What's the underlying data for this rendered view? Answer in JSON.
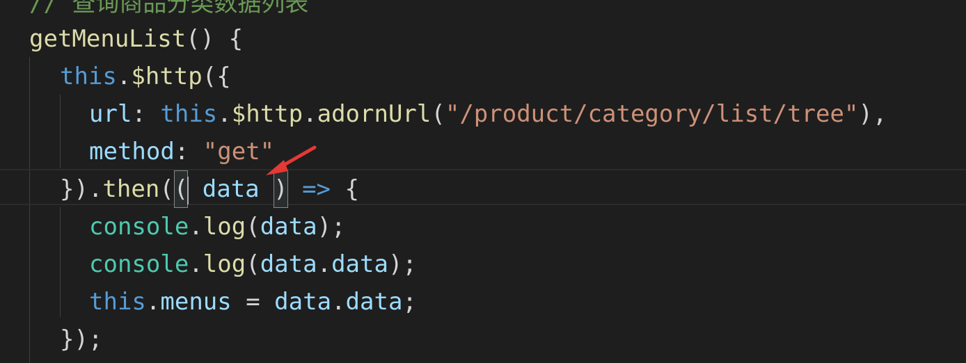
{
  "colors": {
    "background": "#1e1e1e",
    "comment": "#6a9955",
    "function": "#dcdcaa",
    "keyword": "#569cd6",
    "property": "#9cdcfe",
    "string": "#ce9178",
    "class": "#4ec9b0",
    "punctuation": "#d4d4d4",
    "annotation_arrow": "#e53935"
  },
  "code": {
    "comment": "// 查询商品分类数据列表",
    "line2": {
      "func": "getMenuList",
      "rest": "() {"
    },
    "line3": {
      "kw": "this",
      "dot": ".",
      "func": "$http",
      "rest": "({"
    },
    "line4": {
      "prop": "url",
      "colon": ": ",
      "kw": "this",
      "dot": ".",
      "func1": "$http",
      "dot2": ".",
      "func2": "adornUrl",
      "open": "(",
      "str": "\"/product/category/list/tree\"",
      "close": "),"
    },
    "line5": {
      "prop": "method",
      "colon": ": ",
      "str": "\"get\""
    },
    "line6": {
      "lead": "}).",
      "func": "then",
      "open": "(",
      "lparen": "(",
      "param": " data ",
      "rparen": ")",
      "arrow": " =>",
      "rest": " {"
    },
    "line7": {
      "cls": "console",
      "dot": ".",
      "func": "log",
      "open": "(",
      "arg": "data",
      "close": ");"
    },
    "line8": {
      "cls": "console",
      "dot": ".",
      "func": "log",
      "open": "(",
      "arg1": "data",
      "dot2": ".",
      "arg2": "data",
      "close": ");"
    },
    "line9": {
      "kw": "this",
      "dot": ".",
      "prop": "menus",
      "eq": " = ",
      "arg1": "data",
      "dot2": ".",
      "arg2": "data",
      "semi": ";"
    },
    "line10": {
      "rest": "});"
    }
  }
}
